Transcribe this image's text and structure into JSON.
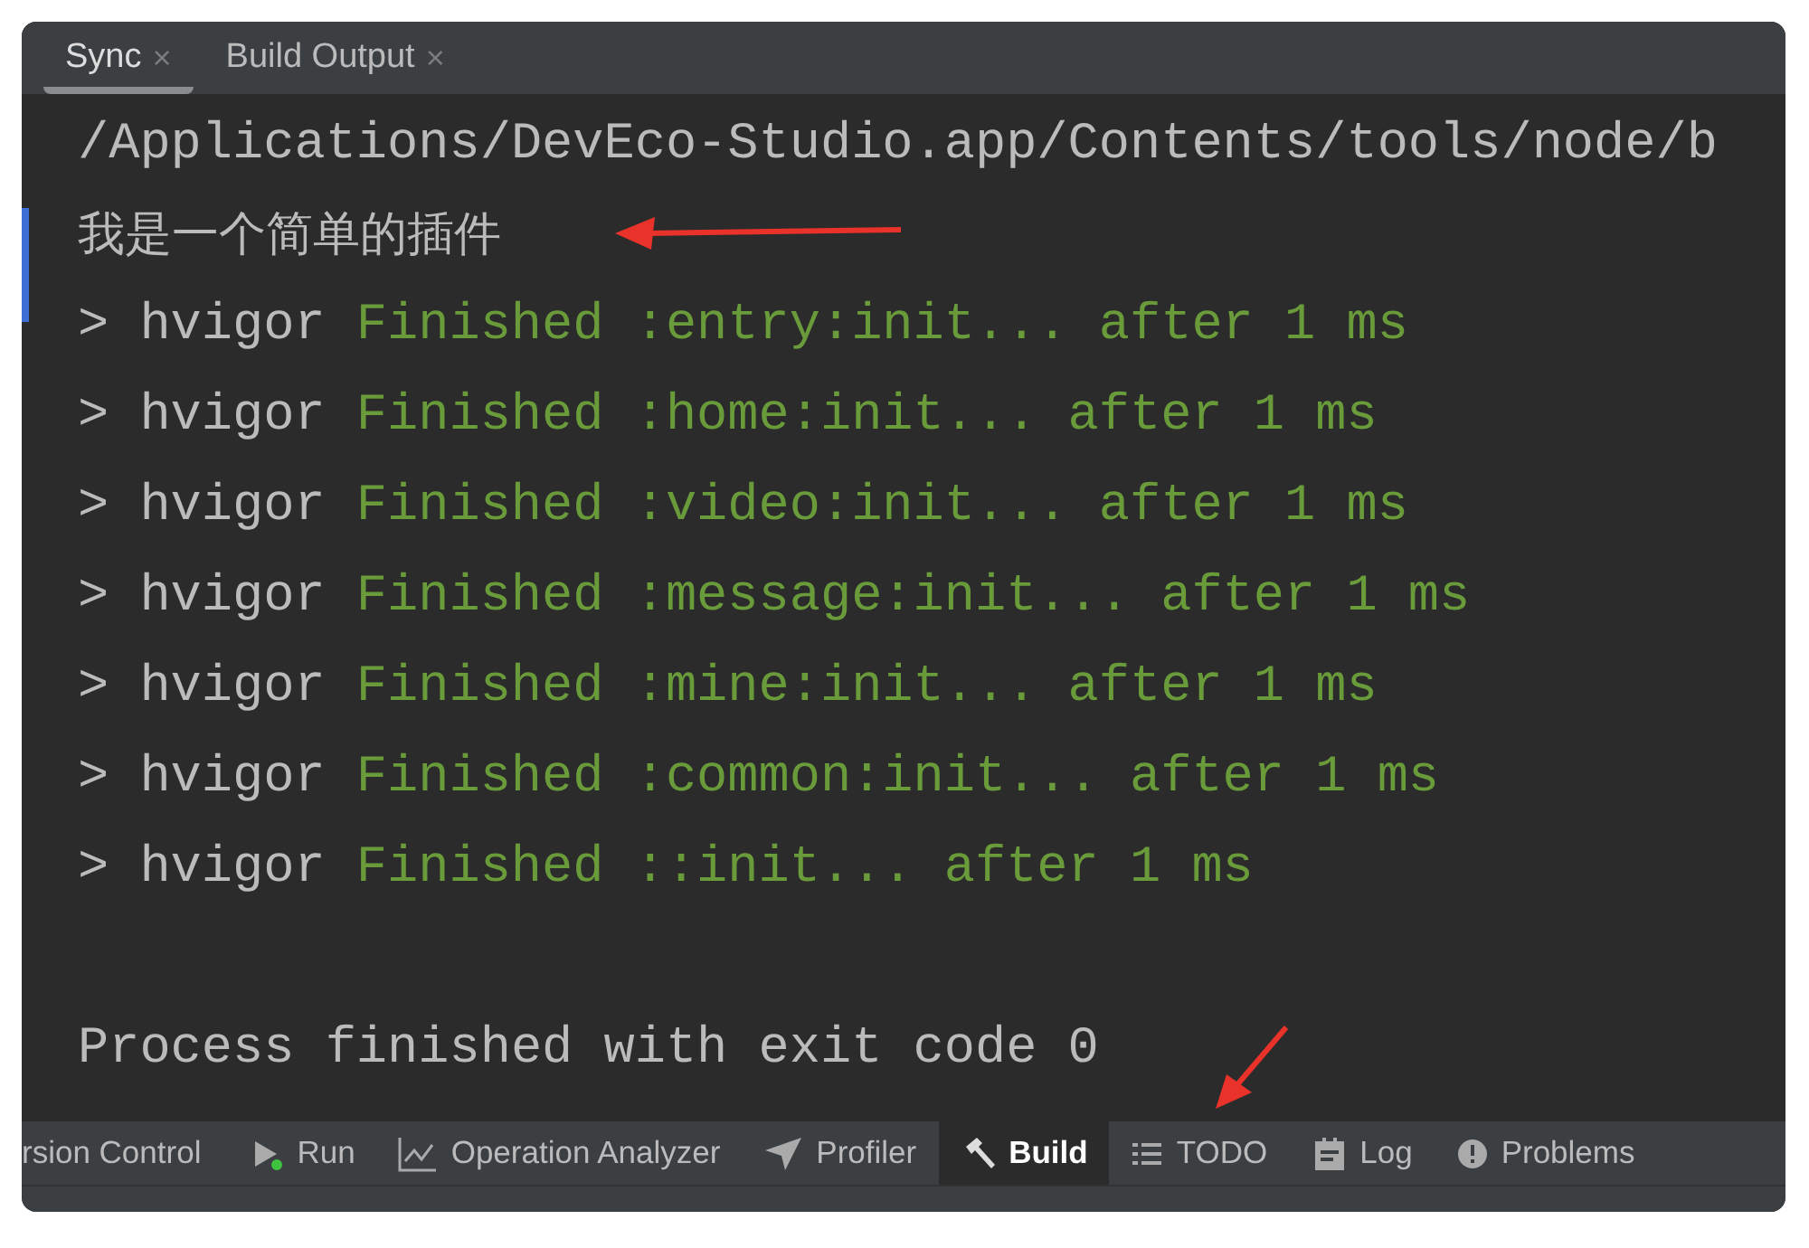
{
  "tabs": [
    {
      "label": "Sync",
      "close": "×",
      "selected": true
    },
    {
      "label": "Build Output",
      "close": "×",
      "selected": false
    }
  ],
  "console": {
    "lines": [
      {
        "kind": "plain",
        "text": "/Applications/DevEco-Studio.app/Contents/tools/node/b"
      },
      {
        "kind": "cjk",
        "text": "我是一个简单的插件"
      },
      {
        "kind": "task",
        "prefix": "> hvigor",
        "message": "Finished :entry:init... after 1 ms"
      },
      {
        "kind": "task",
        "prefix": "> hvigor",
        "message": "Finished :home:init... after 1 ms"
      },
      {
        "kind": "task",
        "prefix": "> hvigor",
        "message": "Finished :video:init... after 1 ms"
      },
      {
        "kind": "task",
        "prefix": "> hvigor",
        "message": "Finished :message:init... after 1 ms"
      },
      {
        "kind": "task",
        "prefix": "> hvigor",
        "message": "Finished :mine:init... after 1 ms"
      },
      {
        "kind": "task",
        "prefix": "> hvigor",
        "message": "Finished :common:init... after 1 ms"
      },
      {
        "kind": "task",
        "prefix": "> hvigor",
        "message": "Finished ::init... after 1 ms"
      },
      {
        "kind": "blank"
      },
      {
        "kind": "plain",
        "text": "Process finished with exit code 0"
      }
    ]
  },
  "tool_windows": [
    {
      "label": "rsion Control",
      "selected": false
    },
    {
      "label": "Run",
      "selected": false
    },
    {
      "label": "Operation Analyzer",
      "selected": false
    },
    {
      "label": "Profiler",
      "selected": false
    },
    {
      "label": "Build",
      "selected": true
    },
    {
      "label": "TODO",
      "selected": false
    },
    {
      "label": "Log",
      "selected": false
    },
    {
      "label": "Problems",
      "selected": false
    }
  ]
}
